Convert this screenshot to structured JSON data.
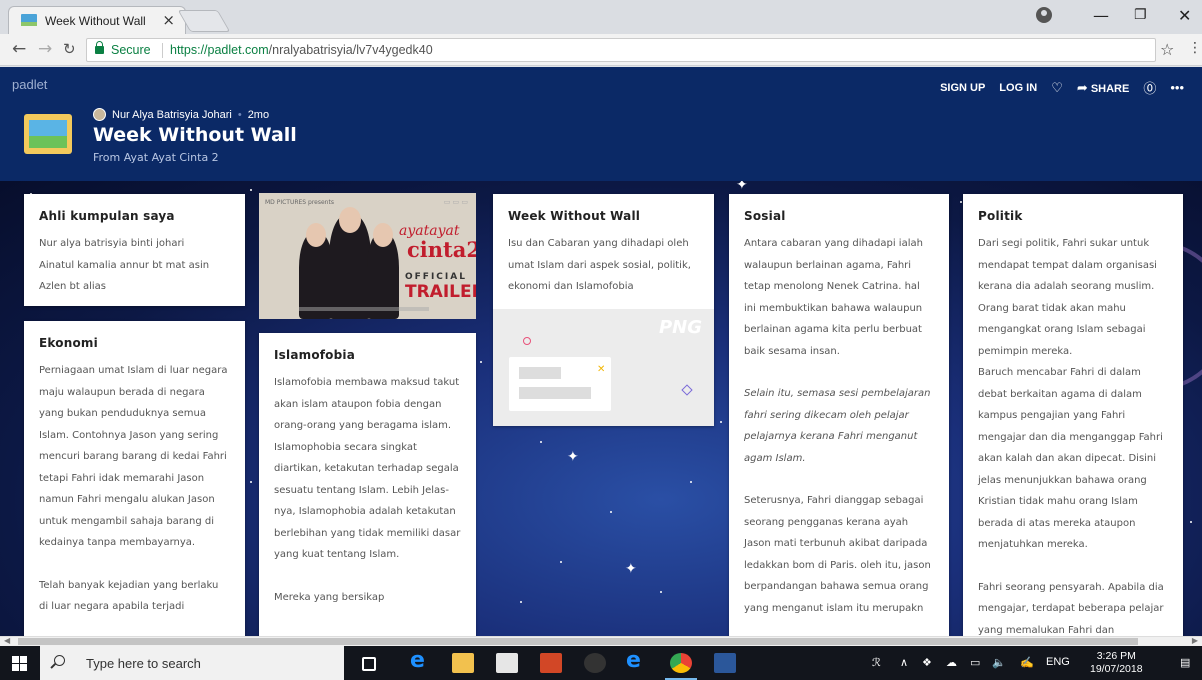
{
  "browser": {
    "tab_title": "Week Without Wall",
    "tab_close": "×",
    "secure_label": "Secure",
    "url_scheme": "https://padlet.com",
    "url_path": "/nralyabatrisyia/lv7v4ygedk40",
    "window_controls": [
      "minimize-icon",
      "restore-icon",
      "close-icon"
    ]
  },
  "padlet": {
    "brand": "padlet",
    "actions": {
      "sign_up": "SIGN UP",
      "log_in": "LOG IN",
      "share": "SHARE"
    },
    "author": "Nur Alya Batrisyia Johari",
    "age": "2mo",
    "title": "Week Without Wall",
    "subtitle": "From Ayat Ayat Cinta 2"
  },
  "cards": {
    "members": {
      "title": "Ahli kumpulan saya",
      "body": "Nur alya batrisyia binti johari\nAinatul kamalia annur bt mat asin\nAzlen bt alias"
    },
    "ekonomi": {
      "title": "Ekonomi",
      "body1": "Perniagaan umat Islam di luar negara maju walaupun berada di negara yang bukan penduduknya semua Islam. Contohnya Jason yang sering mencuri barang barang di kedai Fahri tetapi Fahri idak memarahi Jason namun Fahri mengalu alukan Jason untuk mengambil sahaja barang di kedainya tanpa membayarnya.",
      "body2": "Telah banyak kejadian yang berlaku di luar negara apabila terjadi"
    },
    "poster": {
      "studio": "MD PICTURES presents",
      "title_small": "ayatayat",
      "title_big": "cinta2",
      "official": "OFFICIAL",
      "trailer": "TRAILER"
    },
    "islamofobia": {
      "title": "Islamofobia",
      "body1": "Islamofobia membawa maksud takut akan islam ataupon fobia dengan orang-orang yang beragama islam. Islamophobia secara singkat diartikan, ketakutan terhadap segala sesuatu tentang Islam. Lebih Jelas-\nnya, Islamophobia adalah ketakutan berlebihan yang tidak memiliki dasar yang kuat tentang Islam.",
      "body2": "Mereka yang bersikap"
    },
    "wwwall": {
      "title": "Week Without Wall",
      "body": "Isu dan Cabaran yang dihadapi oleh umat Islam dari aspek sosial, politik, ekonomi dan Islamofobia",
      "png_label": "PNG"
    },
    "sosial": {
      "title": "Sosial",
      "body1": "Antara cabaran yang dihadapi ialah walaupun berlainan agama, Fahri tetap menolong Nenek Catrina. hal ini membuktikan bahawa walaupun berlainan agama kita perlu berbuat baik sesama insan.",
      "body2": "Selain itu, semasa sesi pembelajaran fahri sering dikecam oleh pelajar pelajarnya kerana Fahri menganut agam Islam.",
      "body3": "Seterusnya, Fahri dianggap sebagai seorang pengganas kerana ayah Jason mati terbunuh akibat daripada ledakkan bom di Paris. oleh itu, jason berpandangan bahawa semua orang yang menganut islam itu merupakn"
    },
    "politik": {
      "title": "Politik",
      "body1": "Dari segi politik, Fahri sukar untuk mendapat tempat dalam organisasi kerana dia adalah seorang muslim. Orang barat tidak akan mahu mengangkat orang Islam sebagai pemimpin mereka.\nBaruch mencabar Fahri di dalam debat berkaitan agama di dalam kampus pengajian yang Fahri mengajar dan dia menganggap Fahri akan kalah dan akan dipecat. Disini jelas menunjukkan bahawa orang Kristian tidak mahu orang Islam berada di atas mereka ataupon menjatuhkan mereka.",
      "body2": "Fahri seorang pensyarah. Apabila dia mengajar, terdapat beberapa pelajar yang memalukan Fahri dan"
    }
  },
  "taskbar": {
    "search_placeholder": "Type here to search",
    "lang": "ENG",
    "time": "3:26 PM",
    "date": "19/07/2018"
  },
  "colors": {
    "header_bg": "#0b2966",
    "secure_green": "#0b8043"
  }
}
